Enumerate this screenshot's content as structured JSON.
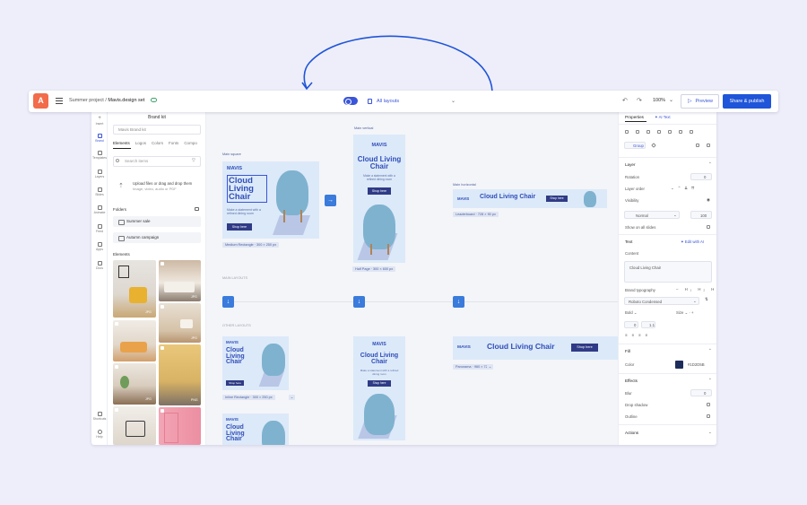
{
  "topbar": {
    "project": "Summer project /",
    "file": "Mavis.design set",
    "layouts_label": "All layouts",
    "zoom": "100%",
    "preview_label": "Preview",
    "share_label": "Share & publish",
    "accent": "#1f55d8",
    "logo_color": "#f26b4a"
  },
  "rail": {
    "items": [
      {
        "label": "Insert",
        "icon": "plus-icon"
      },
      {
        "label": "Brand",
        "icon": "brand-icon"
      },
      {
        "label": "Templates",
        "icon": "templates-icon"
      },
      {
        "label": "Layers",
        "icon": "layers-icon"
      },
      {
        "label": "Slides",
        "icon": "slides-icon"
      },
      {
        "label": "Animate",
        "icon": "animate-icon"
      },
      {
        "label": "Feed",
        "icon": "feed-icon"
      },
      {
        "label": "Apps",
        "icon": "apps-icon"
      },
      {
        "label": "Docs",
        "icon": "docs-icon"
      },
      {
        "label": "Shortcuts",
        "icon": "shortcuts-icon"
      },
      {
        "label": "Help",
        "icon": "help-icon"
      }
    ]
  },
  "brand_panel": {
    "title": "Brand kit",
    "kit_select": "Mavis Brand kit",
    "tabs": [
      "Elements",
      "Logos",
      "Colors",
      "Fonts",
      "Compo"
    ],
    "search_placeholder": "Search items",
    "upload_title": "Upload files or drag and drop them",
    "upload_sub": "Image, video, audio or PDF",
    "folders_label": "Folders",
    "folders": [
      "Summer sale",
      "Autumn campaign"
    ],
    "elements_label": "Elements",
    "thumb_badges": [
      "JPG",
      "JPG",
      "JPG",
      "PNG",
      "JPG",
      "PNG",
      "JPG"
    ]
  },
  "canvas": {
    "main_layouts_label": "MAIN LAYOUTS",
    "other_layouts_label": "OTHER LAYOUTS",
    "frames": {
      "main_square": "Main square",
      "main_vertical": "Main vertical",
      "main_horizontal": "Main horizontal",
      "medium_rect": "Medium Rectangle · 300 × 250 px",
      "half_page": "Half Page · 300 × 600 px",
      "leaderboard": "Leaderboard · 728 × 90 px",
      "inline_rect": "Inline Rectangle · 300 × 250 px",
      "panorama": "Panorama · 960 × 720"
    },
    "ad": {
      "brand": "MAVIS",
      "headline": "Cloud Living Chair",
      "headline_l1": "Cloud",
      "headline_l2": "Living",
      "headline_l3": "Chair",
      "subtext": "Make a statement with a refined dining room",
      "cta": "Shop here"
    }
  },
  "properties": {
    "tab_properties": "Properties",
    "tab_ai": "AI Text",
    "group_label": "Group",
    "layer": "Layer",
    "rotation": "Rotation",
    "rotation_val": "0",
    "layer_order": "Layer order",
    "visibility": "Visibility",
    "blend": "Normal",
    "opacity": "100",
    "show_all_slides": "Show on all slides",
    "text": "Text",
    "edit_ai": "Edit with AI",
    "content": "Content",
    "content_value": "Cloud Living Chair",
    "brand_typography": "Brand typography",
    "font": "Roboto Condensed",
    "weight": "Bold",
    "size": "Size",
    "tracking": "0",
    "line_height": "1.1",
    "fill": "Fill",
    "color_label": "Color",
    "color_hex": "#1D2D5B",
    "effects": "Effects",
    "blur": "Blur",
    "blur_val": "0",
    "drop_shadow": "Drop shadow",
    "outline": "Outline",
    "actions": "Actions"
  }
}
